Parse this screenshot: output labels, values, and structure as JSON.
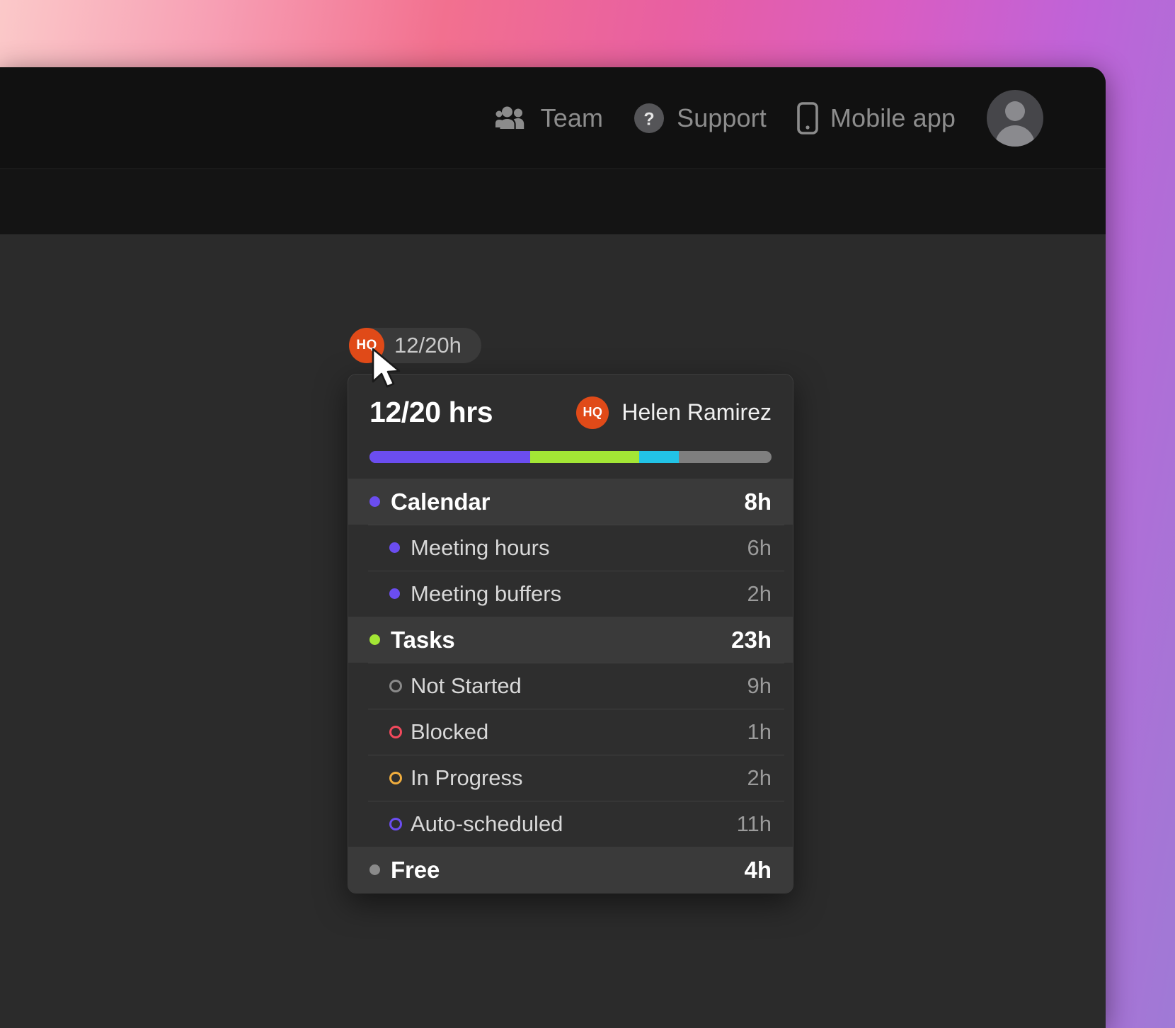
{
  "desktop": {
    "gradient_from": "#fbc9c9",
    "gradient_mid": "#e85fa2",
    "gradient_to": "#9f7ad6"
  },
  "topbar": {
    "items": [
      {
        "label": "Team",
        "icon": "team-icon"
      },
      {
        "label": "Support",
        "icon": "help-circle-icon"
      },
      {
        "label": "Mobile app",
        "icon": "mobile-phone-icon"
      }
    ],
    "avatar": {
      "icon": "user-avatar-placeholder"
    }
  },
  "chip": {
    "initials": "HQ",
    "text": "12/20h",
    "badge_color": "#e04a18"
  },
  "card": {
    "title": "12/20 hrs",
    "owner": {
      "initials": "HQ",
      "name": "Helen Ramirez"
    },
    "progress": {
      "total_hours": 20,
      "segments": [
        {
          "name": "Calendar",
          "hours": 8,
          "color": "#6b4df0"
        },
        {
          "name": "Tasks",
          "hours": 5.4,
          "color": "#a3e635"
        },
        {
          "name": "In Progress",
          "hours": 2,
          "color": "#22c3e6"
        },
        {
          "name": "Free",
          "hours": 4,
          "color": "#7f7f7f"
        }
      ]
    },
    "rows": [
      {
        "type": "group",
        "label": "Calendar",
        "value": "8h",
        "marker": "dot",
        "marker_name": "dot-purple",
        "color": "#6b4df0"
      },
      {
        "type": "sub",
        "label": "Meeting hours",
        "value": "6h",
        "marker": "dot",
        "marker_name": "dot-purple",
        "color": "#6b4df0"
      },
      {
        "type": "sub",
        "label": "Meeting buffers",
        "value": "2h",
        "marker": "dot",
        "marker_name": "dot-purple",
        "color": "#6b4df0"
      },
      {
        "type": "group",
        "label": "Tasks",
        "value": "23h",
        "marker": "dot",
        "marker_name": "dot-green",
        "color": "#a3e635"
      },
      {
        "type": "sub",
        "label": "Not Started",
        "value": "9h",
        "marker": "ring",
        "marker_name": "ring-gray",
        "color": "#8a8a8a"
      },
      {
        "type": "sub",
        "label": "Blocked",
        "value": "1h",
        "marker": "ring",
        "marker_name": "ring-red",
        "color": "#f2495c"
      },
      {
        "type": "sub",
        "label": "In Progress",
        "value": "2h",
        "marker": "ring",
        "marker_name": "ring-amber",
        "color": "#f0ad3e"
      },
      {
        "type": "sub",
        "label": "Auto-scheduled",
        "value": "11h",
        "marker": "ring",
        "marker_name": "ring-purple",
        "color": "#6b4df0"
      },
      {
        "type": "group",
        "label": "Free",
        "value": "4h",
        "marker": "dot",
        "marker_name": "dot-gray",
        "color": "#8a8a8a"
      }
    ]
  }
}
